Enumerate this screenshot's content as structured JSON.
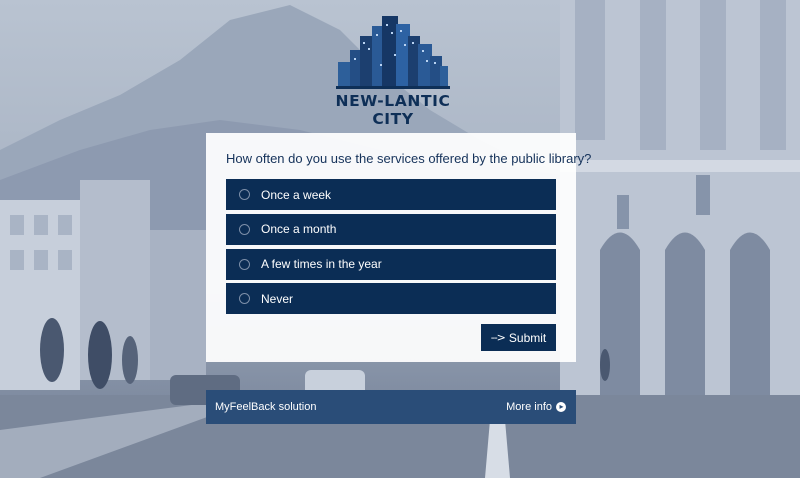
{
  "brand": {
    "logo_text": "NEW-LANTIC CITY",
    "color": "#0e2f57"
  },
  "survey": {
    "question": "How often do you use the services offered by the public library?",
    "options": [
      {
        "label": "Once a week"
      },
      {
        "label": "Once a month"
      },
      {
        "label": "A few times in the year"
      },
      {
        "label": "Never"
      }
    ],
    "submit_label": "Submit",
    "submit_icon": "dashed-arrow-icon",
    "option_bg": "#0b2d55"
  },
  "footer": {
    "brand_label": "MyFeelBack solution",
    "more_info_label": "More info",
    "more_info_icon": "arrow-circle-right-icon",
    "bg": "#2a4d78"
  }
}
